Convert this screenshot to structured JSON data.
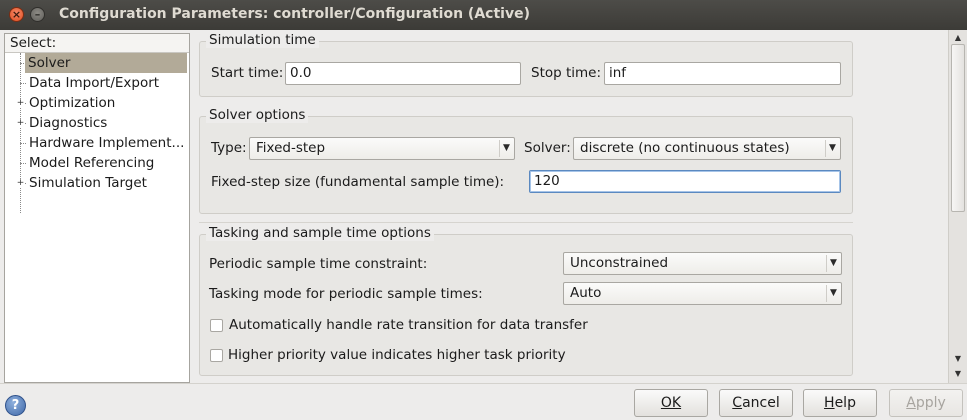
{
  "window": {
    "title": "Configuration Parameters: controller/Configuration (Active)",
    "close_glyph": "×",
    "minimize_glyph": "–"
  },
  "tree": {
    "header": "Select:",
    "items": [
      {
        "label": "Solver",
        "expandable": false,
        "selected": true
      },
      {
        "label": "Data Import/Export",
        "expandable": false,
        "selected": false
      },
      {
        "label": "Optimization",
        "expandable": true,
        "selected": false
      },
      {
        "label": "Diagnostics",
        "expandable": true,
        "selected": false
      },
      {
        "label": "Hardware Implement...",
        "expandable": false,
        "selected": false
      },
      {
        "label": "Model Referencing",
        "expandable": false,
        "selected": false
      },
      {
        "label": "Simulation Target",
        "expandable": true,
        "selected": false
      }
    ],
    "expander_glyph": "+"
  },
  "simulation_time": {
    "title": "Simulation time",
    "start_label": "Start time:",
    "start_value": "0.0",
    "stop_label": "Stop time:",
    "stop_value": "inf"
  },
  "solver_options": {
    "title": "Solver options",
    "type_label": "Type:",
    "type_value": "Fixed-step",
    "solver_label": "Solver:",
    "solver_value": "discrete (no continuous states)",
    "step_label": "Fixed-step size (fundamental sample time):",
    "step_value": "120"
  },
  "tasking": {
    "title": "Tasking and sample time options",
    "constraint_label": "Periodic sample time constraint:",
    "constraint_value": "Unconstrained",
    "mode_label": "Tasking mode for periodic sample times:",
    "mode_value": "Auto",
    "rate_transition_label": "Automatically handle rate transition for data transfer",
    "rate_transition_checked": false,
    "priority_label": "Higher priority value indicates higher task priority",
    "priority_checked": false
  },
  "buttons": {
    "ok": "OK",
    "cancel_first": "C",
    "cancel_rest": "ancel",
    "help_first": "H",
    "help_rest": "elp",
    "apply_first": "A",
    "apply_rest": "pply",
    "help_icon": "?"
  },
  "dropdown_arrow": "▼",
  "scroll": {
    "up": "▲",
    "down": "▼"
  }
}
